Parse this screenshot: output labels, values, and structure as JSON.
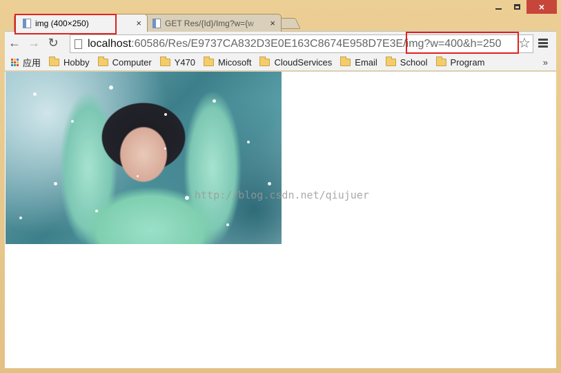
{
  "window": {
    "controls": {
      "minimize_icon": "minimize-icon",
      "maximize_icon": "maximize-icon",
      "close_label": "×"
    }
  },
  "tabs": [
    {
      "title": "img (400×250)",
      "close_label": "×",
      "active": true
    },
    {
      "title": "GET Res/{Id}/Img?w={w",
      "close_label": "×",
      "active": false
    }
  ],
  "toolbar": {
    "back_label": "←",
    "forward_label": "→",
    "reload_label": "↻",
    "url_host": "localhost",
    "url_path": ":60586/Res/E9737CA832D3E0E163C8674E958D7E3E/img?w=400&h=250",
    "star_label": "☆"
  },
  "bookmarks": {
    "apps_label": "应用",
    "items": [
      "Hobby",
      "Computer",
      "Y470",
      "Micosoft",
      "CloudServices",
      "Email",
      "School",
      "Program"
    ],
    "more_label": "»"
  },
  "content": {
    "watermark": "http://blog.csdn.net/qiujuer"
  },
  "colors": {
    "highlight": "#e02020",
    "frame": "#eccf95",
    "close_button": "#c7463b"
  }
}
